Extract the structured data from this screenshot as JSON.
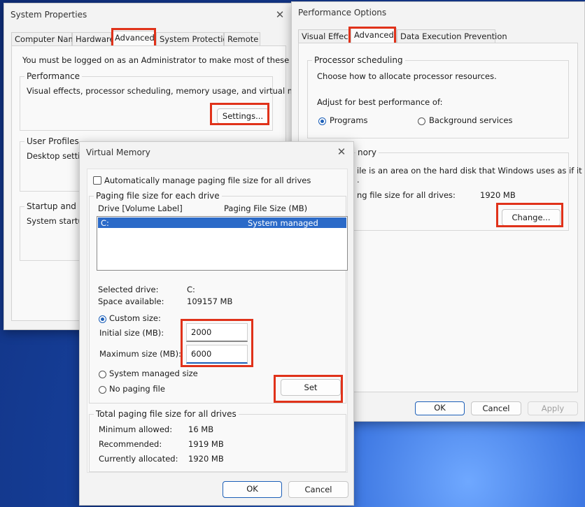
{
  "system_properties": {
    "title": "System Properties",
    "tabs": [
      "Computer Name",
      "Hardware",
      "Advanced",
      "System Protection",
      "Remote"
    ],
    "active_tab": "Advanced",
    "admin_notice": "You must be logged on as an Administrator to make most of these changes.",
    "performance": {
      "label": "Performance",
      "desc": "Visual effects, processor scheduling, memory usage, and virtual memory",
      "button": "Settings..."
    },
    "user_profiles": {
      "label": "User Profiles",
      "desc": "Desktop settings"
    },
    "startup": {
      "label": "Startup and Rec",
      "desc": "System startup, s"
    }
  },
  "performance_options": {
    "title": "Performance Options",
    "tabs": [
      "Visual Effects",
      "Advanced",
      "Data Execution Prevention"
    ],
    "active_tab": "Advanced",
    "processor": {
      "label": "Processor scheduling",
      "desc": "Choose how to allocate processor resources.",
      "adjust": "Adjust for best performance of:",
      "programs": "Programs",
      "background": "Background services"
    },
    "virtual_memory": {
      "label_partial": "nory",
      "desc_partial": "ile is an area on the hard disk that Windows uses as if it",
      "desc_partial2": ".",
      "total_label_partial": "ng file size for all drives:",
      "total_value": "1920 MB",
      "change_button": "Change..."
    },
    "ok": "OK",
    "cancel": "Cancel",
    "apply": "Apply"
  },
  "virtual_memory": {
    "title": "Virtual Memory",
    "auto_manage": "Automatically manage paging file size for all drives",
    "paging_group": "Paging file size for each drive",
    "col_drive": "Drive  [Volume Label]",
    "col_size": "Paging File Size (MB)",
    "row_drive": "C:",
    "row_size": "System managed",
    "selected_drive_label": "Selected drive:",
    "selected_drive_value": "C:",
    "space_label": "Space available:",
    "space_value": "109157 MB",
    "custom_size": "Custom size:",
    "initial_label": "Initial size (MB):",
    "initial_value": "2000",
    "max_label": "Maximum size (MB):",
    "max_value": "6000",
    "system_managed": "System managed size",
    "no_paging": "No paging file",
    "set_button": "Set",
    "total_group": "Total paging file size for all drives",
    "min_label": "Minimum allowed:",
    "min_value": "16 MB",
    "rec_label": "Recommended:",
    "rec_value": "1919 MB",
    "cur_label": "Currently allocated:",
    "cur_value": "1920 MB",
    "ok": "OK",
    "cancel": "Cancel"
  },
  "colors": {
    "highlight": "#e0321a",
    "selection": "#2b6ac8",
    "accent": "#1c5fb8"
  }
}
